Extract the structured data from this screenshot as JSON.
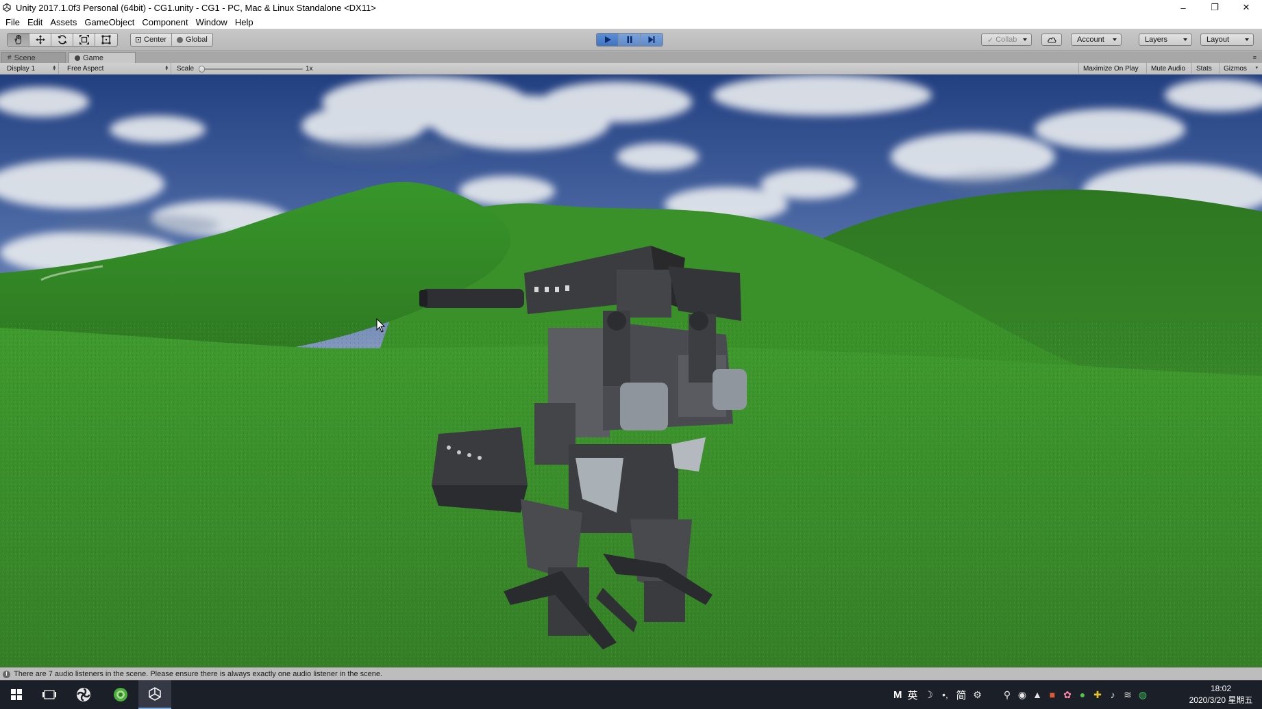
{
  "window": {
    "title": "Unity 2017.1.0f3 Personal (64bit) - CG1.unity - CG1 - PC, Mac & Linux Standalone <DX11>",
    "controls": {
      "minimize": "–",
      "restore": "❐",
      "close": "✕"
    }
  },
  "menu": [
    "File",
    "Edit",
    "Assets",
    "GameObject",
    "Component",
    "Window",
    "Help"
  ],
  "toolbar": {
    "transform_tools": [
      "hand-tool",
      "move-tool",
      "rotate-tool",
      "scale-tool",
      "rect-tool"
    ],
    "pivot_mode": "Center",
    "pivot_rotation": "Global",
    "collab_label": "Collab",
    "account_label": "Account",
    "layers_label": "Layers",
    "layout_label": "Layout",
    "play_state": "playing"
  },
  "tabs": {
    "scene_label": "Scene",
    "game_label": "Game",
    "active": "Game"
  },
  "gameview": {
    "display": "Display 1",
    "aspect": "Free Aspect",
    "scale_label": "Scale",
    "scale_value": "1x",
    "maximize_on_play": "Maximize On Play",
    "mute_audio": "Mute Audio",
    "stats": "Stats",
    "gizmos": "Gizmos"
  },
  "colors": {
    "sky_top": "#2a4a8c",
    "sky_horizon": "#6f86b8",
    "grass": "#3d8f2c",
    "grass_dark": "#2a6d1f",
    "robot": "#3a3b3e",
    "play_blue": "#3f73c2"
  },
  "status": {
    "message": "There are 7 audio listeners in the scene. Please ensure there is always exactly one audio listener in the scene."
  },
  "taskbar": {
    "apps": [
      "windows-start-icon",
      "task-view-icon",
      "app-icon",
      "browser-icon",
      "unity-icon"
    ],
    "ime_mode": "M",
    "ime_lang": "英",
    "ime_simplified": "简",
    "time": "18:02",
    "date": "2020/3/20 星期五"
  }
}
